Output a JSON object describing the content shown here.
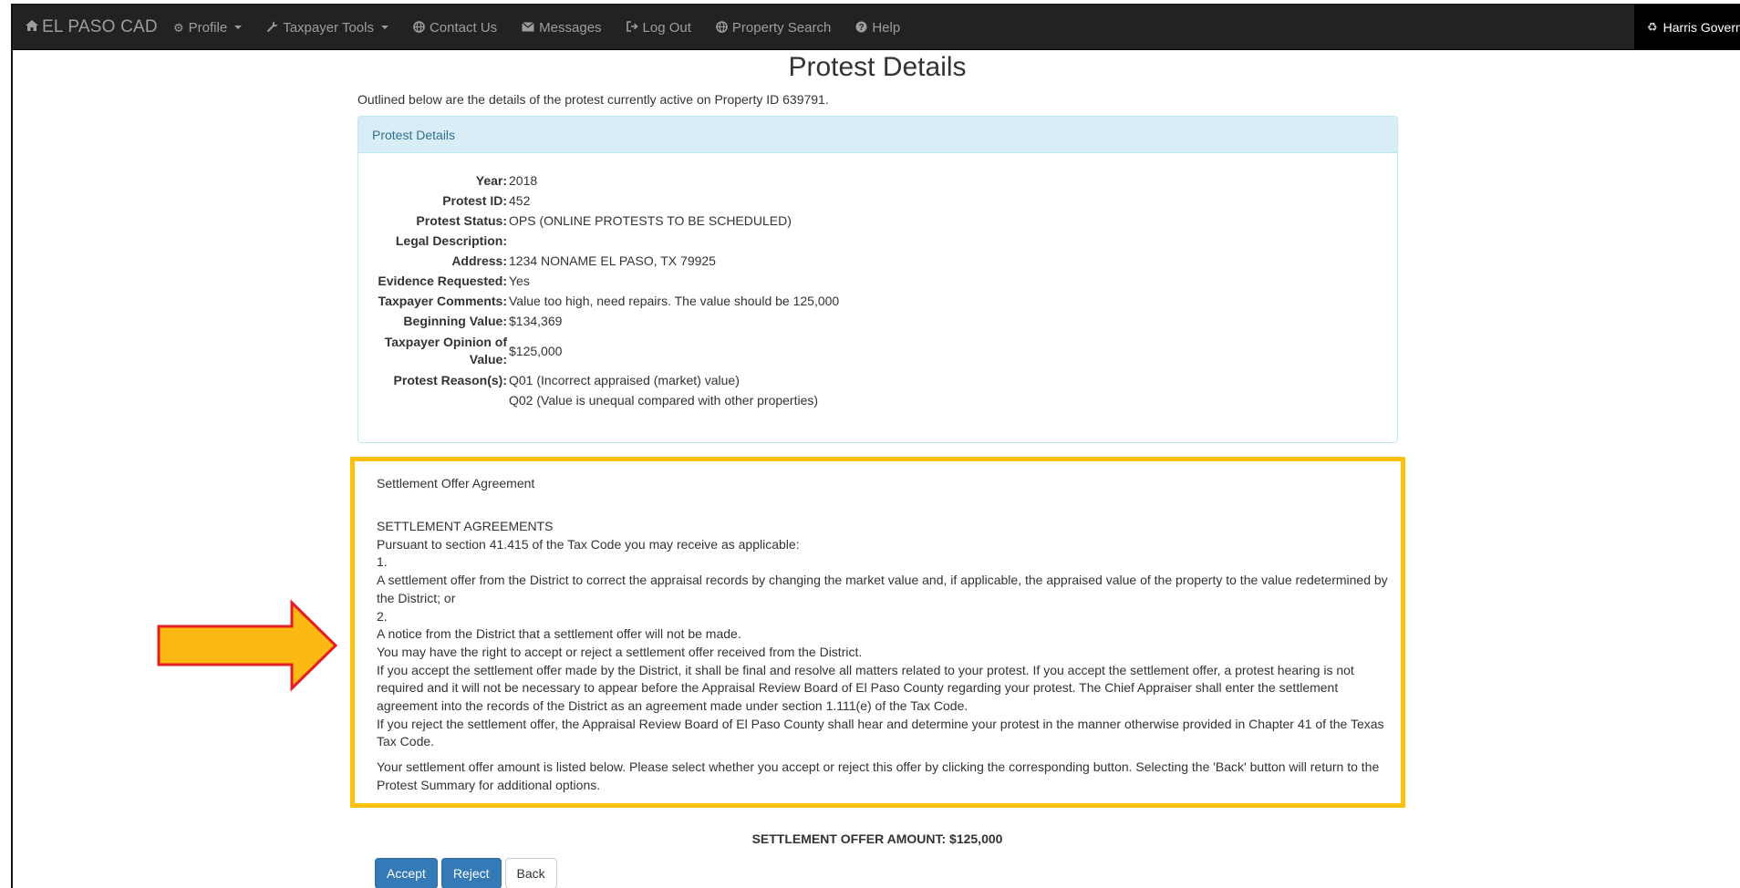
{
  "nav": {
    "brand": "EL PASO CAD",
    "items": [
      {
        "label": "Profile",
        "icon": "gears-icon",
        "dropdown": true
      },
      {
        "label": "Taxpayer Tools",
        "icon": "wrench-icon",
        "dropdown": true
      },
      {
        "label": "Contact Us",
        "icon": "globe-icon",
        "dropdown": false
      },
      {
        "label": "Messages",
        "icon": "envelope-icon",
        "dropdown": false
      },
      {
        "label": "Log Out",
        "icon": "logout-icon",
        "dropdown": false
      },
      {
        "label": "Property Search",
        "icon": "globe-icon",
        "dropdown": false
      },
      {
        "label": "Help",
        "icon": "question-circle-icon",
        "dropdown": false
      }
    ],
    "right_label": "Harris Govern"
  },
  "page": {
    "title": "Protest Details",
    "intro": "Outlined below are the details of the protest currently active on Property ID 639791."
  },
  "details": {
    "heading": "Protest Details",
    "year_label": "Year:",
    "year": "2018",
    "protest_id_label": "Protest ID:",
    "protest_id": "452",
    "status_label": "Protest Status:",
    "status": "OPS (ONLINE PROTESTS TO BE SCHEDULED)",
    "legal_label": "Legal Description:",
    "legal": "",
    "address_label": "Address:",
    "address": "1234 NONAME EL PASO, TX 79925",
    "evidence_label": "Evidence Requested:",
    "evidence": "Yes",
    "comments_label": "Taxpayer Comments:",
    "comments": "Value too high, need repairs. The value should be 125,000",
    "beginning_label": "Beginning Value:",
    "beginning": "$134,369",
    "opinion_label_1": "Taxpayer Opinion of",
    "opinion_label_2": "Value:",
    "opinion": "$125,000",
    "reasons_label": "Protest Reason(s):",
    "reasons": [
      "Q01 (Incorrect appraised (market) value)",
      "Q02 (Value is unequal compared with other properties)"
    ]
  },
  "settlement": {
    "label": "Settlement Offer Agreement",
    "lines": [
      "SETTLEMENT AGREEMENTS",
      "Pursuant to section 41.415 of the Tax Code you may receive as applicable:",
      "1.",
      "A settlement offer from the District to correct the appraisal records by changing the market value and, if applicable, the appraised value of the property to the value redetermined by the District; or",
      "2.",
      "A notice from the District that a settlement offer will not be made.",
      "You may have the right to accept or reject a settlement offer received from the District.",
      "If you accept the settlement offer made by the District, it shall be final and resolve all matters related to your protest. If you accept the settlement offer, a protest hearing is not required and it will not be necessary to appear before the Appraisal Review Board of El Paso County regarding your protest. The Chief Appraiser shall enter the settlement agreement into the records of the District as an agreement made under section 1.111(e) of the Tax Code.",
      "If you reject the settlement offer, the Appraisal Review Board of El Paso County shall hear and determine your protest in the manner otherwise provided in Chapter 41 of the Texas Tax Code."
    ],
    "final": "Your settlement offer amount is listed below. Please select whether you accept or reject this offer by clicking the corresponding button. Selecting the 'Back' button will return to the Protest Summary for additional options.",
    "highlight_color": "#fdc10a"
  },
  "offer": {
    "text": "SETTLEMENT OFFER AMOUNT: $125,000"
  },
  "buttons": {
    "accept": "Accept",
    "reject": "Reject",
    "back": "Back"
  },
  "annotation": {
    "arrow_fill": "#fdb913",
    "arrow_stroke": "#e31e24"
  }
}
